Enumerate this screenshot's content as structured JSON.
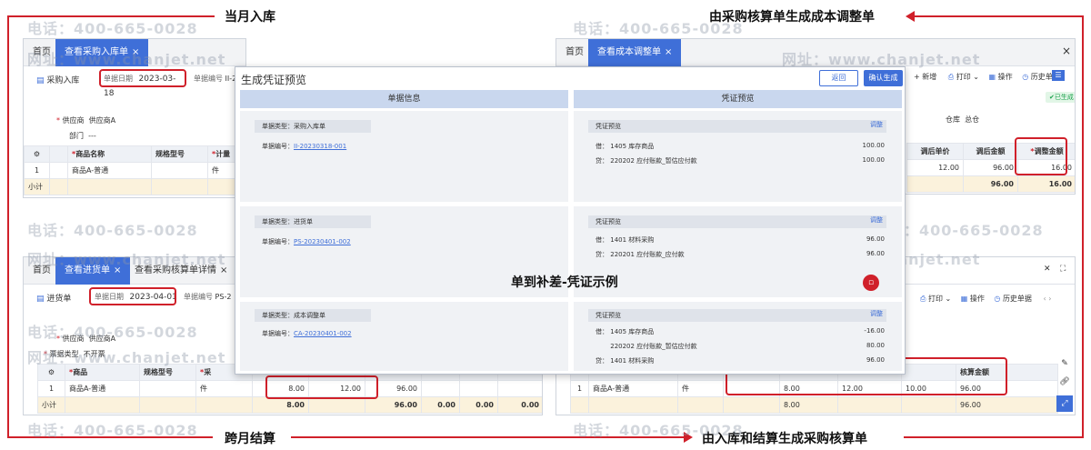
{
  "labels": {
    "top_left": "当月入库",
    "top_right": "由采购核算单生成成本调整单",
    "bottom_left": "跨月结算",
    "bottom_right": "由入库和结算生成采购核算单",
    "center": "单到补差-凭证示例"
  },
  "watermark": {
    "phone": "电话：400-665-0028",
    "site": "网址：www.chanjet.net"
  },
  "colors": {
    "accent": "#3f6fd8",
    "highlight": "#d0202a",
    "header_bg": "#c9d7ee"
  },
  "win1": {
    "tab_home": "首页",
    "tab_active": "查看采购入库单",
    "page_title": "采购入库",
    "date_label": "单据日期",
    "date_value": "2023-03-18",
    "code_label": "单据编号",
    "code_value": "II-2",
    "supplier_label": "供应商",
    "supplier_value": "供应商A",
    "dept_label": "部门",
    "dept_value": "---",
    "cols": [
      "商品名称",
      "规格型号",
      "计量"
    ],
    "row": {
      "no": "1",
      "name": "商品A-普通",
      "unit": "件"
    },
    "sum_label": "小计"
  },
  "win2": {
    "tab_home": "首页",
    "tab_active": "查看成本调整单",
    "toolbar": [
      "+ 新增",
      "打印",
      "操作",
      "历史单据"
    ],
    "status": "已生成",
    "warehouse_label": "仓库",
    "warehouse_value": "总仓",
    "cols": [
      "调后单价",
      "调后金额",
      "调整金额"
    ],
    "row": [
      "12.00",
      "96.00",
      "16.00"
    ],
    "sum": [
      "96.00",
      "16.00"
    ]
  },
  "win3": {
    "tab_home": "首页",
    "tab_active": "查看进货单",
    "tab2": "查看采购核算单详情",
    "page_title": "进货单",
    "date_label": "单据日期",
    "date_value": "2023-04-01",
    "code_label": "单据编号",
    "code_value": "PS-2",
    "supplier_label": "供应商",
    "supplier_value": "供应商A",
    "invoice_label": "票据类型",
    "invoice_value": "不开票",
    "cols": [
      "商品",
      "规格型号",
      "采"
    ],
    "row": {
      "no": "1",
      "name": "商品A-普通",
      "unit": "件",
      "qty": "8.00",
      "price": "12.00",
      "amount": "96.00"
    },
    "sum": {
      "label": "小计",
      "qty": "8.00",
      "amount": "96.00",
      "c1": "0.00",
      "c2": "0.00",
      "c3": "0.00"
    }
  },
  "win4": {
    "toolbar": [
      "打印",
      "操作",
      "历史单据"
    ],
    "col_cost": "核算金额",
    "row": {
      "no": "1",
      "name": "商品A-普通",
      "unit": "件",
      "qty": "8.00",
      "price": "12.00",
      "v": "10.00",
      "cost": "96.00"
    },
    "sum": {
      "qty": "8.00",
      "cost": "96.00"
    }
  },
  "modal": {
    "title": "生成凭证预览",
    "back": "返回",
    "confirm": "确认生成",
    "left_header": "单据信息",
    "right_header": "凭证预览",
    "doc_type_label": "单据类型：",
    "doc_no_label": "单据编号：",
    "voucher_label": "凭证预览",
    "adjust": "调整",
    "sections": [
      {
        "type": "采购入库单",
        "no": "II-20230318-001",
        "lines": [
          {
            "dc": "借：",
            "acct": "1405  库存商品",
            "amt": "100.00"
          },
          {
            "dc": "贷：",
            "acct": "220202  应付账款_暂估应付款",
            "amt": "100.00"
          }
        ]
      },
      {
        "type": "进货单",
        "no": "PS-20230401-002",
        "lines": [
          {
            "dc": "借：",
            "acct": "1401  材料采购",
            "amt": "96.00"
          },
          {
            "dc": "贷：",
            "acct": "220201  应付账款_应付款",
            "amt": "96.00"
          }
        ]
      },
      {
        "type": "成本调整单",
        "no": "CA-20230401-002",
        "lines": [
          {
            "dc": "借：",
            "acct": "1405  库存商品",
            "amt": "-16.00"
          },
          {
            "dc": "",
            "acct": "220202  应付账款_暂估应付款",
            "amt": "80.00"
          },
          {
            "dc": "贷：",
            "acct": "1401  材料采购",
            "amt": "96.00"
          }
        ]
      }
    ]
  }
}
